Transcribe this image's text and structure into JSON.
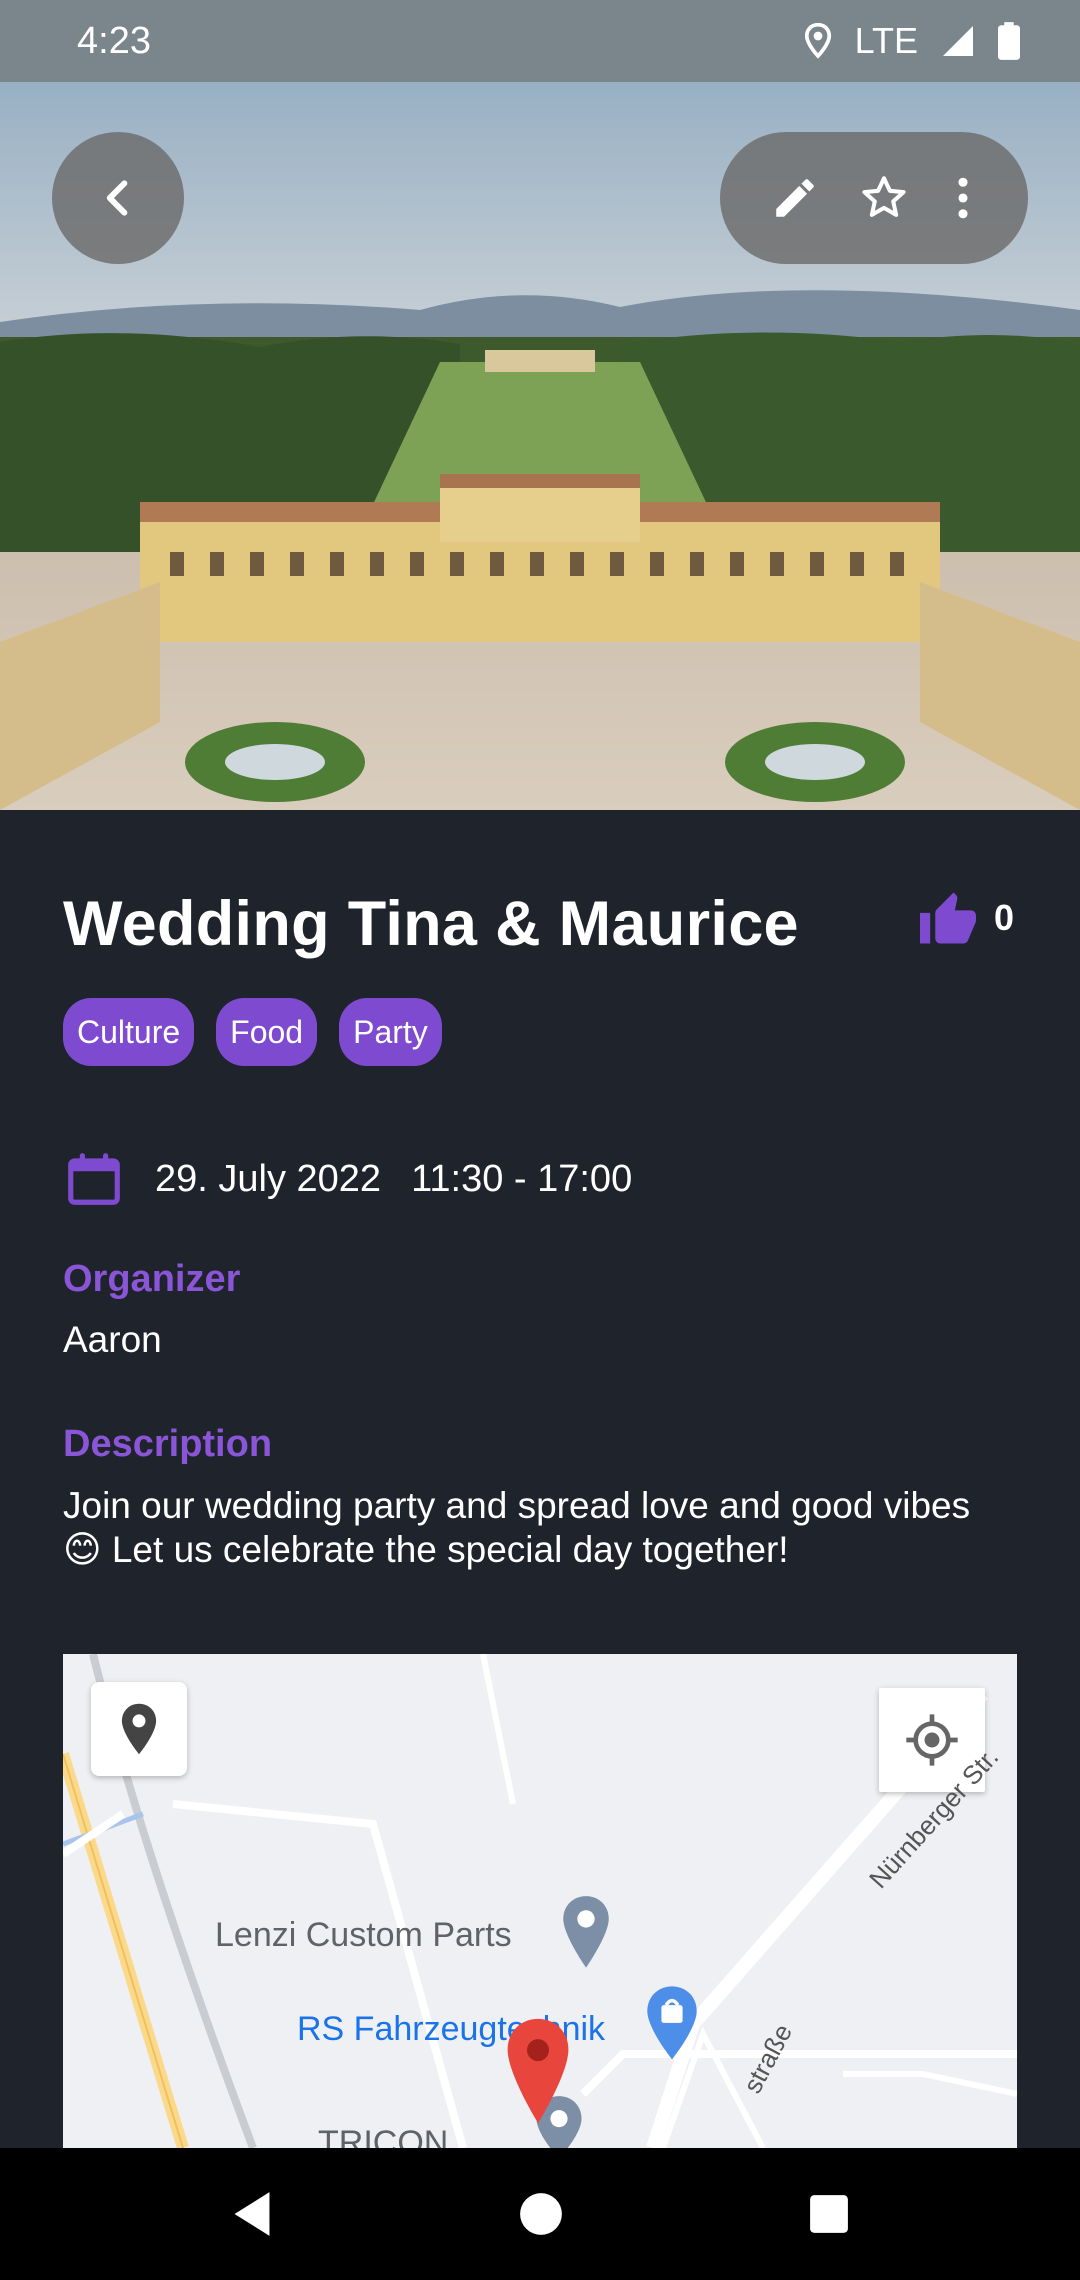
{
  "status_bar": {
    "time": "4:23",
    "network": "LTE"
  },
  "event": {
    "title": "Wedding Tina & Maurice",
    "likes": "0",
    "tags": [
      "Culture",
      "Food",
      "Party"
    ],
    "date": "29. July 2022",
    "time": "11:30 - 17:00",
    "organizer_label": "Organizer",
    "organizer": "Aaron",
    "description_label": "Description",
    "description_line1": "Join our wedding party and spread love and good vibes",
    "description_line2": "😊 Let us celebrate the special day together!"
  },
  "map": {
    "poi_1": "Lenzi Custom Parts",
    "poi_2": "RS Fahrzeugtechnik",
    "street_1": "Nürnberger Str.",
    "street_2": "straße",
    "poi_3": "TRICON"
  },
  "colors": {
    "accent": "#7e4bd0",
    "background": "#1f232c",
    "status_bar": "#7b858c",
    "map_pin": "#e8453c"
  },
  "icons": [
    "back-arrow-icon",
    "edit-icon",
    "star-icon",
    "more-vert-icon",
    "thumb-up-icon",
    "calendar-icon",
    "location-pin-icon",
    "my-location-icon"
  ]
}
